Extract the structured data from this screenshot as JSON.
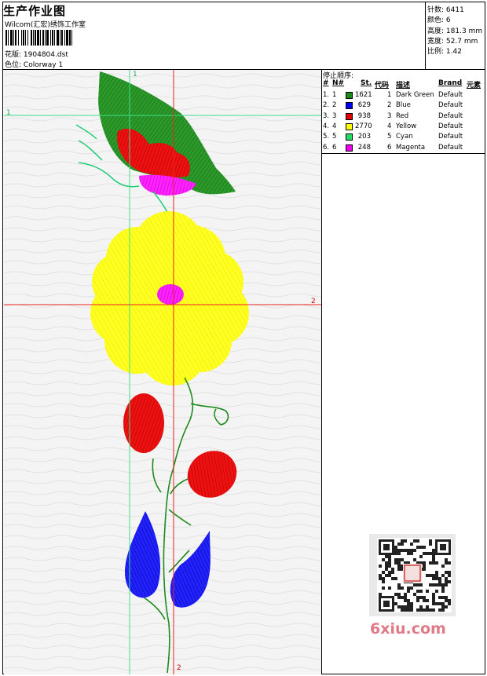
{
  "header": {
    "title": "生产作业图",
    "studio": "Wilcom(汇宏)绣饰工作室",
    "design_label": "花版:",
    "design_value": "1904804.dst",
    "colorway_label": "色位:",
    "colorway_value": "Colorway 1"
  },
  "stats": {
    "stitches_label": "针数:",
    "stitches_value": "6411",
    "colors_label": "颜色:",
    "colors_value": "6",
    "height_label": "高度:",
    "height_value": "181.3 mm",
    "width_label": "宽度:",
    "width_value": "52.7 mm",
    "scale_label": "比例:",
    "scale_value": "1.42"
  },
  "stop_sequence": {
    "title": "停止顺序:",
    "columns": [
      "#",
      "N#",
      "St.",
      "代码",
      "描述",
      "Brand",
      "元素"
    ],
    "rows": [
      {
        "idx": "1.",
        "n": "1",
        "color": "#1a8a1a",
        "st": "1621",
        "code": "1",
        "desc": "Dark Green",
        "brand": "Default"
      },
      {
        "idx": "2.",
        "n": "2",
        "color": "#0000ee",
        "st": "629",
        "code": "2",
        "desc": "Blue",
        "brand": "Default"
      },
      {
        "idx": "3.",
        "n": "3",
        "color": "#e00000",
        "st": "938",
        "code": "3",
        "desc": "Red",
        "brand": "Default"
      },
      {
        "idx": "4.",
        "n": "4",
        "color": "#ffff00",
        "st": "2770",
        "code": "4",
        "desc": "Yellow",
        "brand": "Default"
      },
      {
        "idx": "5.",
        "n": "5",
        "color": "#22dd66",
        "st": "203",
        "code": "5",
        "desc": "Cyan",
        "brand": "Default"
      },
      {
        "idx": "6.",
        "n": "6",
        "color": "#ee00ee",
        "st": "248",
        "code": "6",
        "desc": "Magenta",
        "brand": "Default"
      }
    ]
  },
  "canvas": {
    "axis_labels": {
      "h1": "1",
      "h2": "2",
      "v1": "1",
      "v2": "2"
    }
  },
  "watermark": "6xiu.com",
  "qr_seal_text": "汇宏"
}
